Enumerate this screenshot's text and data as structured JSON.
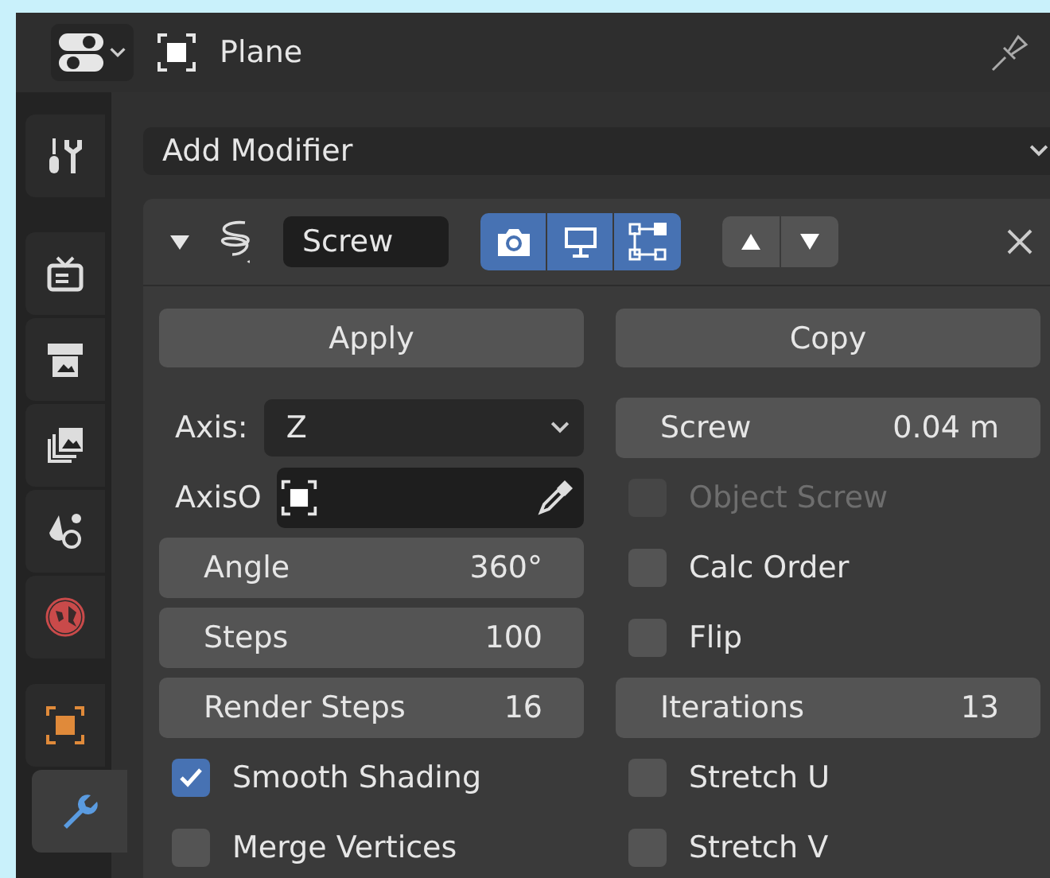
{
  "header": {
    "object_name": "Plane"
  },
  "sidebar": {
    "tabs": [
      {
        "kind": "tool",
        "selected": false
      },
      {
        "kind": "render",
        "selected": false
      },
      {
        "kind": "output",
        "selected": false
      },
      {
        "kind": "view_layer",
        "selected": false
      },
      {
        "kind": "scene",
        "selected": false
      },
      {
        "kind": "world",
        "selected": false
      },
      {
        "kind": "object",
        "selected": false
      },
      {
        "kind": "modifiers",
        "selected": true
      }
    ]
  },
  "add_modifier": {
    "label": "Add Modifier"
  },
  "modifier": {
    "name": "Screw",
    "expanded": true,
    "toggles": [
      {
        "kind": "render",
        "on": true
      },
      {
        "kind": "viewport",
        "on": true
      },
      {
        "kind": "edit_mode",
        "on": true
      }
    ],
    "buttons": [
      "Apply",
      "Copy"
    ],
    "left": [
      {
        "kind": "dropdown",
        "label": "Axis:",
        "value": "Z"
      },
      {
        "kind": "object",
        "label": "AxisO"
      },
      {
        "kind": "number",
        "label": "Angle",
        "value": "360°"
      },
      {
        "kind": "number",
        "label": "Steps",
        "value": "100"
      },
      {
        "kind": "number",
        "label": "Render Steps",
        "value": "16"
      },
      {
        "kind": "checkbox",
        "label": "Smooth Shading",
        "checked": true,
        "disabled": false
      },
      {
        "kind": "checkbox",
        "label": "Merge Vertices",
        "checked": false,
        "disabled": false
      }
    ],
    "right": [
      {
        "kind": "number",
        "label": "Screw",
        "value": "0.04 m"
      },
      {
        "kind": "checkbox",
        "label": "Object Screw",
        "checked": false,
        "disabled": true
      },
      {
        "kind": "checkbox",
        "label": "Calc Order",
        "checked": false,
        "disabled": false
      },
      {
        "kind": "checkbox",
        "label": "Flip",
        "checked": false,
        "disabled": false
      },
      {
        "kind": "number",
        "label": "Iterations",
        "value": "13"
      },
      {
        "kind": "checkbox",
        "label": "Stretch U",
        "checked": false,
        "disabled": false
      },
      {
        "kind": "checkbox",
        "label": "Stretch V",
        "checked": false,
        "disabled": false
      }
    ]
  }
}
